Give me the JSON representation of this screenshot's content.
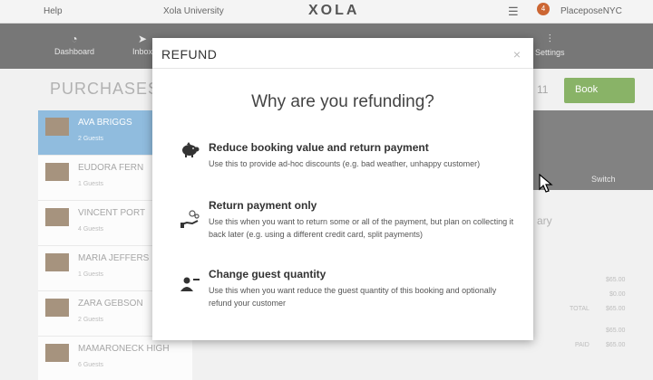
{
  "topbar": {
    "help": "Help",
    "university": "Xola University",
    "logo": "XOLA",
    "notification_count": "4",
    "user": "PlaceposeNYC"
  },
  "nav": {
    "items": [
      {
        "label": "Dashboard",
        "icon": "gauge-icon"
      },
      {
        "label": "Inbox",
        "icon": "paper-plane-icon"
      },
      {
        "label": "Settings",
        "icon": "sliders-icon"
      }
    ]
  },
  "background": {
    "page_title": "PURCHASES",
    "page_number": "11",
    "book_button": "Book",
    "switch_label": "Switch",
    "right_heading": "ary",
    "list": [
      {
        "name": "AVA BRIGGS",
        "sub": "2 Guests"
      },
      {
        "name": "EUDORA FERN",
        "sub": "1 Guests"
      },
      {
        "name": "VINCENT PORT",
        "sub": "4 Guests"
      },
      {
        "name": "MARIA JEFFERS",
        "sub": "1 Guests"
      },
      {
        "name": "ZARA GEBSON",
        "sub": "2 Guests"
      },
      {
        "name": "MAMARONECK HIGH",
        "sub": "6 Guests"
      }
    ],
    "amounts": [
      "$65.00",
      "$0.00",
      "$65.00",
      "$65.00",
      "$65.00"
    ],
    "labels": [
      "TOTAL",
      "PAID"
    ]
  },
  "modal": {
    "title": "REFUND",
    "close": "×",
    "question": "Why are you refunding?",
    "options": [
      {
        "icon": "piggy-bank-icon",
        "label": "Reduce booking value and return payment",
        "description": "Use this to provide ad-hoc discounts (e.g. bad weather, unhappy customer)"
      },
      {
        "icon": "hand-coins-icon",
        "label": "Return payment only",
        "description": "Use this when you want to return some or all of the payment, but plan on collecting it back later (e.g. using a different credit card, split payments)"
      },
      {
        "icon": "guest-remove-icon",
        "label": "Change guest quantity",
        "description": "Use this when you want reduce the guest quantity of this booking and optionally refund your customer"
      }
    ]
  }
}
